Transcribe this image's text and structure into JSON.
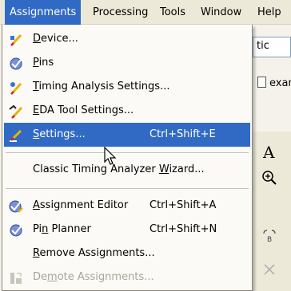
{
  "menubar": {
    "items": [
      "Assignments",
      "Processing",
      "Tools",
      "Window",
      "Help"
    ],
    "active_index": 0
  },
  "background": {
    "field_text": "tic",
    "tab_text": "exam",
    "toolbar_glyph": "A",
    "zoom_icon": "zoom-in-icon"
  },
  "menu": {
    "items": [
      {
        "pre": "",
        "u": "D",
        "post": "evice...",
        "shortcut": "",
        "icon": "device-icon",
        "state": "normal"
      },
      {
        "pre": "",
        "u": "P",
        "post": "ins",
        "shortcut": "",
        "icon": "pins-icon",
        "state": "normal"
      },
      {
        "pre": "",
        "u": "T",
        "post": "iming Analysis Settings...",
        "shortcut": "",
        "icon": "timing-analysis-icon",
        "state": "normal"
      },
      {
        "pre": "",
        "u": "E",
        "post": "DA Tool Settings...",
        "shortcut": "",
        "icon": "eda-tool-icon",
        "state": "normal"
      },
      {
        "pre": "",
        "u": "S",
        "post": "ettings...",
        "shortcut": "Ctrl+Shift+E",
        "icon": "settings-icon",
        "state": "highlighted"
      },
      {
        "pre": "Classic Timing Analyzer ",
        "u": "W",
        "post": "izard...",
        "shortcut": "",
        "icon": "",
        "state": "normal"
      },
      {
        "pre": "",
        "u": "A",
        "post": "ssignment Editor",
        "shortcut": "Ctrl+Shift+A",
        "icon": "assignment-editor-icon",
        "state": "normal"
      },
      {
        "pre": "Pi",
        "u": "n",
        "post": " Planner",
        "shortcut": "Ctrl+Shift+N",
        "icon": "pin-planner-icon",
        "state": "normal"
      },
      {
        "pre": "",
        "u": "R",
        "post": "emove Assignments...",
        "shortcut": "",
        "icon": "",
        "state": "normal"
      },
      {
        "pre": "De",
        "u": "m",
        "post": "ote Assignments...",
        "shortcut": "",
        "icon": "demote-icon",
        "state": "disabled"
      }
    ]
  },
  "colors": {
    "highlight": "#316ac5",
    "menubar_bg": "#ece9d8",
    "disabled_text": "#a7a59a"
  }
}
